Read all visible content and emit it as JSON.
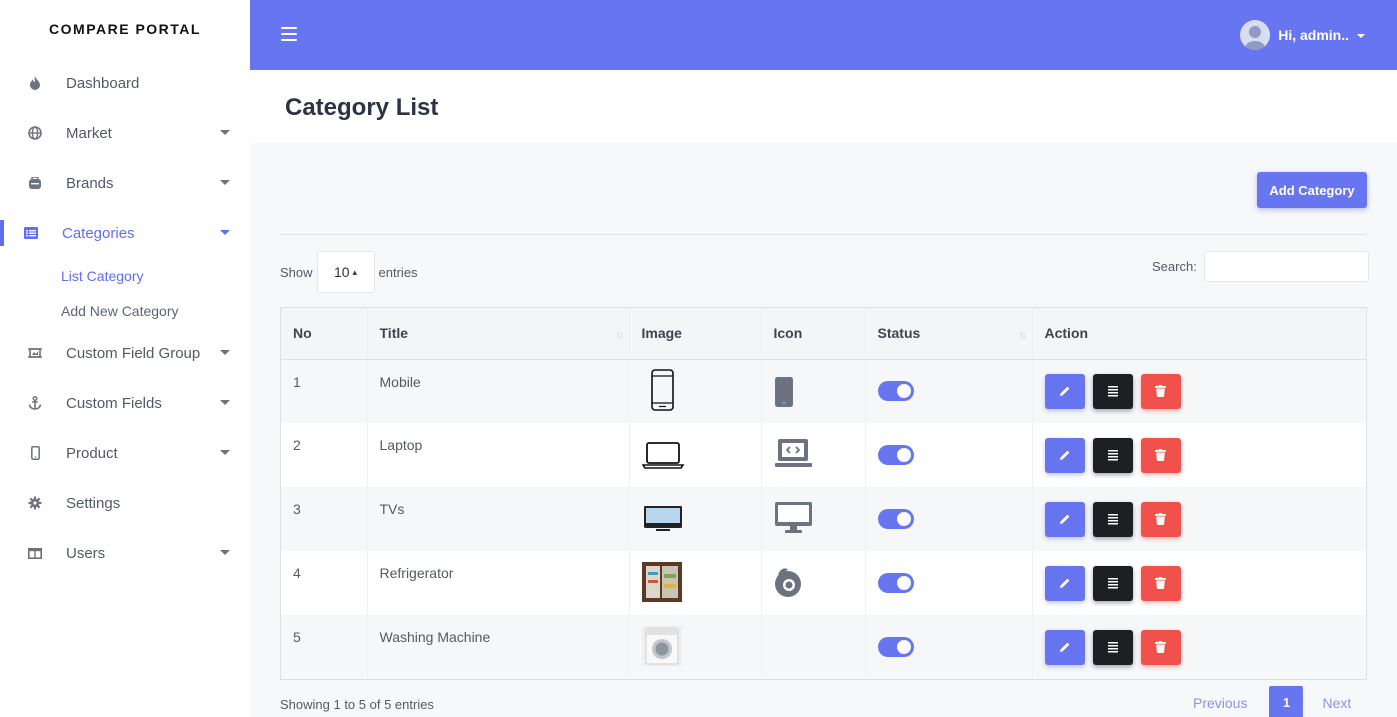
{
  "brand": "COMPARE PORTAL",
  "sidebar": {
    "items": [
      {
        "label": "Dashboard",
        "icon": "fire-icon"
      },
      {
        "label": "Market",
        "icon": "globe-icon"
      },
      {
        "label": "Brands",
        "icon": "tag-icon"
      },
      {
        "label": "Categories",
        "icon": "list-icon",
        "active": true
      },
      {
        "label": "Custom Field Group",
        "icon": "crop-icon"
      },
      {
        "label": "Custom Fields",
        "icon": "anchor-icon"
      },
      {
        "label": "Product",
        "icon": "phone-icon"
      },
      {
        "label": "Settings",
        "icon": "gear-icon"
      },
      {
        "label": "Users",
        "icon": "table-icon"
      }
    ],
    "sub_items": [
      {
        "label": "List Category",
        "active": true
      },
      {
        "label": "Add New Category"
      }
    ]
  },
  "topbar": {
    "user_label": "Hi, admin.."
  },
  "page": {
    "title": "Category List",
    "add_button": "Add Category"
  },
  "table_controls": {
    "show_label": "Show",
    "entries_label": "entries",
    "page_length": "10",
    "search_label": "Search:",
    "search_value": ""
  },
  "table": {
    "columns": [
      "No",
      "Title",
      "Image",
      "Icon",
      "Status",
      "Action"
    ],
    "rows": [
      {
        "no": "1",
        "title": "Mobile",
        "image": "smartphone-outline",
        "icon": "mobile-icon",
        "status": "on"
      },
      {
        "no": "2",
        "title": "Laptop",
        "image": "laptop-outline",
        "icon": "laptop-code-icon",
        "status": "on"
      },
      {
        "no": "3",
        "title": "TVs",
        "image": "tv-image",
        "icon": "desktop-icon",
        "status": "on"
      },
      {
        "no": "4",
        "title": "Refrigerator",
        "image": "refrigerator-photo",
        "icon": "firefox-icon",
        "status": "on"
      },
      {
        "no": "5",
        "title": "Washing Machine",
        "image": "washing-machine-photo",
        "icon": "",
        "status": "on"
      }
    ]
  },
  "footer": {
    "info": "Showing 1 to 5 of 5 entries",
    "previous": "Previous",
    "page": "1",
    "next": "Next"
  },
  "colors": {
    "accent": "#6875f0",
    "danger": "#f0524b",
    "dark": "#1d1f22"
  }
}
